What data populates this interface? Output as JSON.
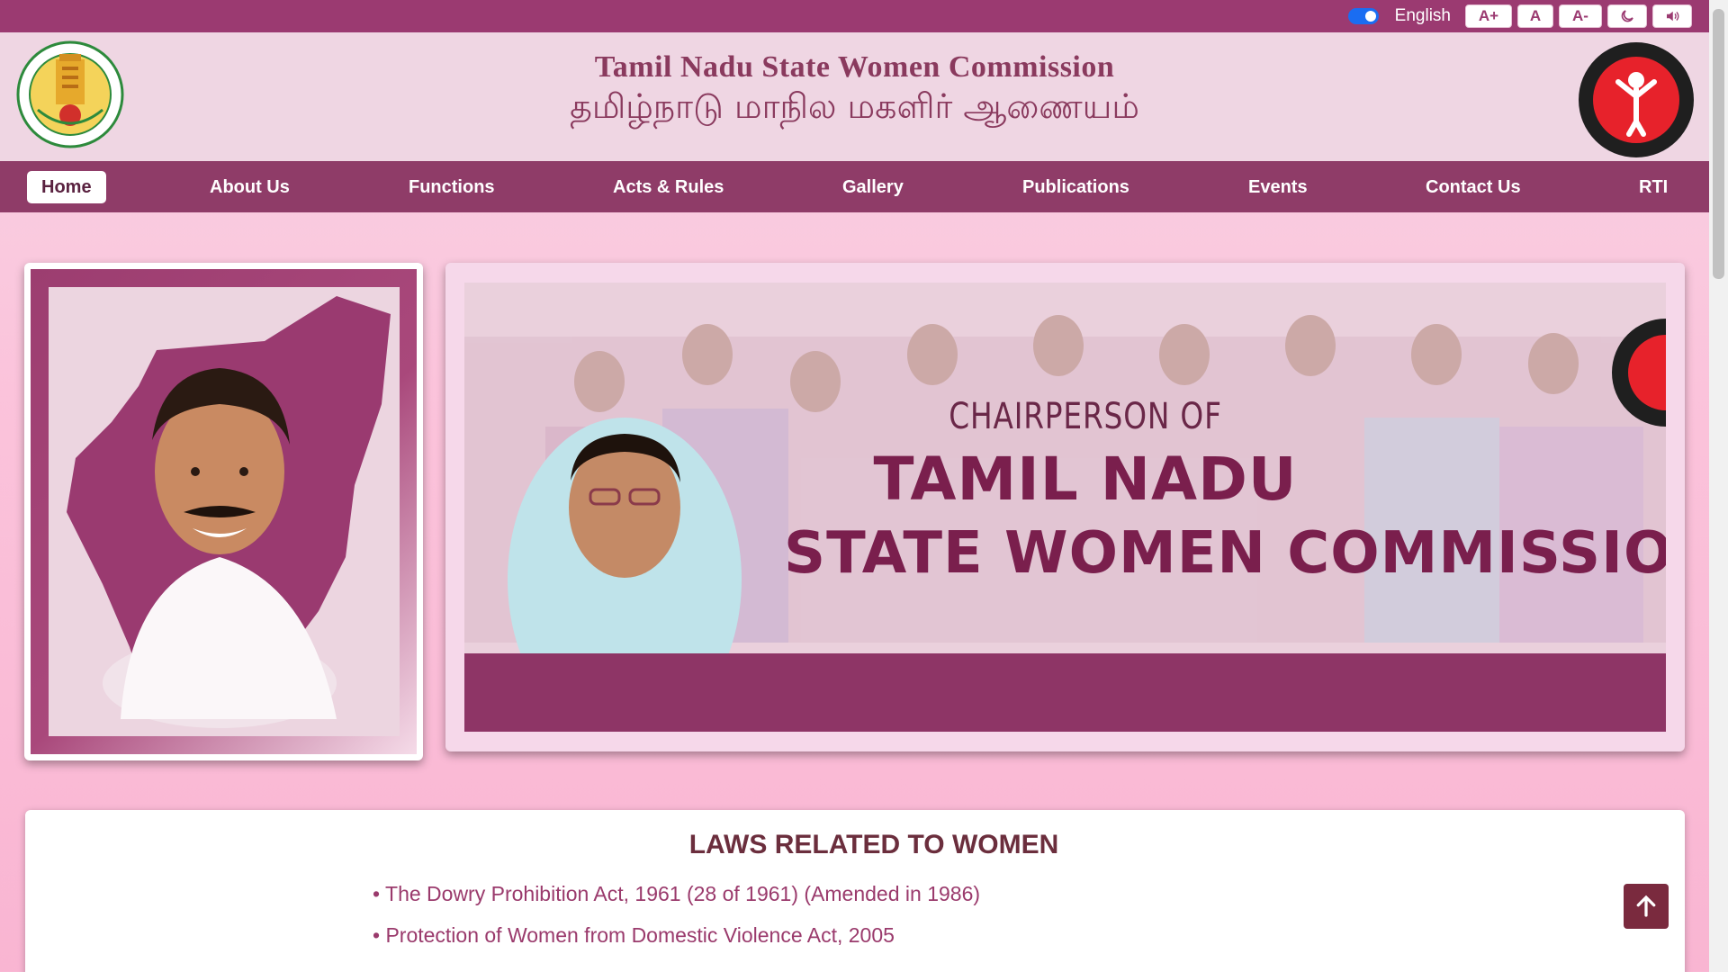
{
  "topbar": {
    "language_label": "English",
    "font_increase": "A+",
    "font_normal": "A",
    "font_decrease": "A-",
    "dark_mode_icon": "moon-icon",
    "audio_icon": "speaker-icon"
  },
  "header": {
    "title_en": "Tamil Nadu State Women Commission",
    "title_ta": "தமிழ்நாடு மாநில மகளிர் ஆணையம்",
    "left_emblem": "tamil-nadu-government-emblem",
    "right_emblem": "women-commission-logo"
  },
  "nav": {
    "items": [
      {
        "label": "Home",
        "active": true
      },
      {
        "label": "About Us"
      },
      {
        "label": "Functions"
      },
      {
        "label": "Acts & Rules"
      },
      {
        "label": "Gallery"
      },
      {
        "label": "Publications"
      },
      {
        "label": "Events"
      },
      {
        "label": "Contact Us"
      },
      {
        "label": "RTI"
      }
    ]
  },
  "banner": {
    "line1": "CHAIRPERSON OF",
    "line2": "TAMIL NADU",
    "line3": "STATE WOMEN COMMISSION"
  },
  "laws": {
    "title": "LAWS RELATED TO WOMEN",
    "items": [
      "• The Dowry Prohibition Act, 1961 (28 of 1961) (Amended in 1986)",
      "• Protection of Women from Domestic Violence Act, 2005"
    ]
  },
  "colors": {
    "brand": "#9b3a71",
    "nav_bg": "#8f3c68",
    "header_bg": "#efd6e3",
    "title_text": "#8a3a5e",
    "link": "#9a3a6c",
    "scroll_top_bg": "#7a2a3e"
  }
}
